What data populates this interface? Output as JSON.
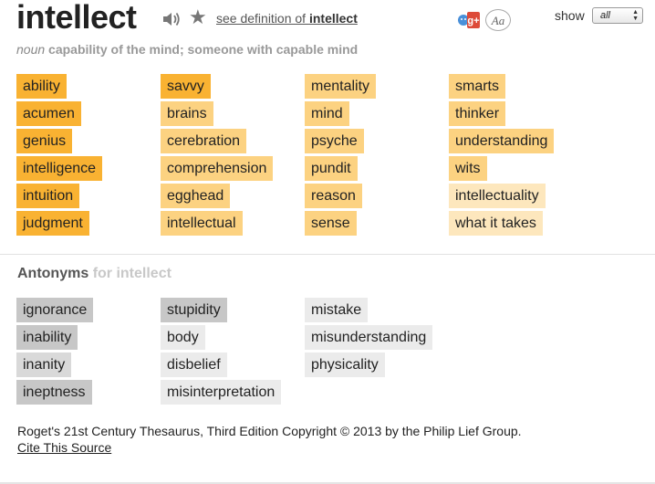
{
  "header": {
    "headword": "intellect",
    "see_definition_prefix": "see definition of ",
    "see_definition_word": "intellect",
    "show_label": "show",
    "show_value": "all",
    "font_button": "Aa"
  },
  "definition": {
    "pos": "noun",
    "text": "capability of the mind; someone with capable mind"
  },
  "synonyms": {
    "columns": [
      [
        {
          "word": "ability",
          "relevance": 3
        },
        {
          "word": "acumen",
          "relevance": 3
        },
        {
          "word": "genius",
          "relevance": 3
        },
        {
          "word": "intelligence",
          "relevance": 3
        },
        {
          "word": "intuition",
          "relevance": 3
        },
        {
          "word": "judgment",
          "relevance": 3
        }
      ],
      [
        {
          "word": "savvy",
          "relevance": 3
        },
        {
          "word": "brains",
          "relevance": 2
        },
        {
          "word": "cerebration",
          "relevance": 2
        },
        {
          "word": "comprehension",
          "relevance": 2
        },
        {
          "word": "egghead",
          "relevance": 2
        },
        {
          "word": "intellectual",
          "relevance": 2
        }
      ],
      [
        {
          "word": "mentality",
          "relevance": 2
        },
        {
          "word": "mind",
          "relevance": 2
        },
        {
          "word": "psyche",
          "relevance": 2
        },
        {
          "word": "pundit",
          "relevance": 2
        },
        {
          "word": "reason",
          "relevance": 2
        },
        {
          "word": "sense",
          "relevance": 2
        }
      ],
      [
        {
          "word": "smarts",
          "relevance": 2
        },
        {
          "word": "thinker",
          "relevance": 2
        },
        {
          "word": "understanding",
          "relevance": 2
        },
        {
          "word": "wits",
          "relevance": 2
        },
        {
          "word": "intellectuality",
          "relevance": 1
        },
        {
          "word": "what it takes",
          "relevance": 1
        }
      ]
    ]
  },
  "antonyms": {
    "heading": "Antonyms",
    "heading_for": "for intellect",
    "columns": [
      [
        {
          "word": "ignorance",
          "relevance": 3
        },
        {
          "word": "inability",
          "relevance": 3
        },
        {
          "word": "inanity",
          "relevance": 2
        },
        {
          "word": "ineptness",
          "relevance": 3
        }
      ],
      [
        {
          "word": "stupidity",
          "relevance": 3
        },
        {
          "word": "body",
          "relevance": 1
        },
        {
          "word": "disbelief",
          "relevance": 1
        },
        {
          "word": "misinterpretation",
          "relevance": 1
        }
      ],
      [
        {
          "word": "mistake",
          "relevance": 1
        },
        {
          "word": "misunderstanding",
          "relevance": 1
        },
        {
          "word": "physicality",
          "relevance": 1
        }
      ]
    ]
  },
  "footer": {
    "copyright": "Roget's 21st Century Thesaurus, Third Edition Copyright © 2013 by the Philip Lief Group.",
    "cite": "Cite This Source"
  },
  "colors": {
    "synonym_high": "#f9b232",
    "synonym_mid": "#fcd281",
    "synonym_low": "#fde7bd",
    "antonym_high": "#c7c7c7",
    "antonym_mid": "#d9d9d9",
    "antonym_low": "#ebebeb"
  },
  "icons": [
    "speaker-icon",
    "star-icon",
    "google-plus-icon",
    "font-size-icon",
    "select-arrows-icon"
  ]
}
